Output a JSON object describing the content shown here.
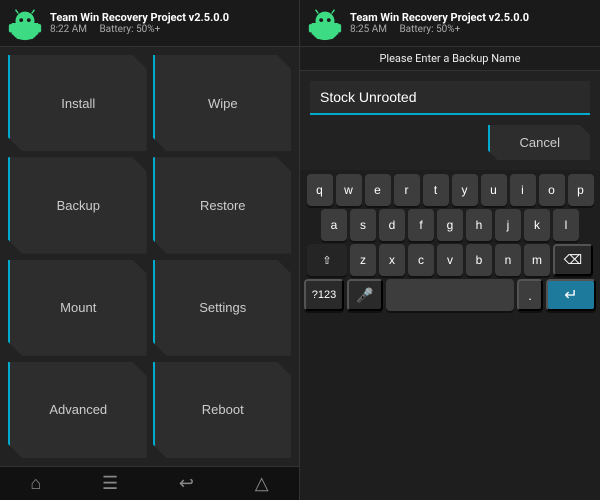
{
  "app": {
    "title": "Team Win Recovery Project  v2.5.0.0",
    "accent": "#00aacc"
  },
  "left": {
    "header": {
      "title": "Team Win Recovery Project  v2.5.0.0",
      "time": "8:22 AM",
      "battery": "Battery: 50%+"
    },
    "buttons": [
      "Install",
      "Wipe",
      "Backup",
      "Restore",
      "Mount",
      "Settings",
      "Advanced",
      "Reboot"
    ],
    "bottom_icons": [
      "home",
      "menu",
      "back",
      "home2"
    ]
  },
  "right": {
    "header": {
      "title": "Team Win Recovery Project  v2.5.0.0",
      "time": "8:25 AM",
      "battery": "Battery: 50%+"
    },
    "prompt": "Please Enter a Backup Name",
    "input_value": "Stock Unrooted",
    "cancel_label": "Cancel",
    "keyboard": {
      "row1": [
        "q",
        "w",
        "e",
        "r",
        "t",
        "y",
        "u",
        "i",
        "o",
        "p"
      ],
      "row2": [
        "a",
        "s",
        "d",
        "f",
        "g",
        "h",
        "j",
        "k",
        "l"
      ],
      "row3": [
        "z",
        "x",
        "c",
        "v",
        "b",
        "n",
        "m"
      ],
      "num_label": "?123",
      "mic_icon": "🎤",
      "dot_label": ".",
      "backspace_icon": "⌫",
      "enter_icon": "↵"
    }
  }
}
